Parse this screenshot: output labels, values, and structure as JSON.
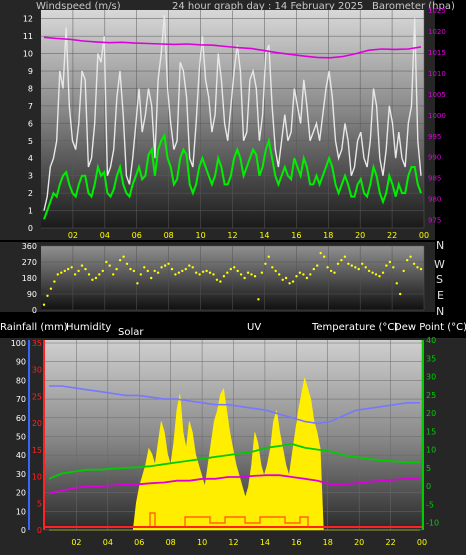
{
  "header": {
    "wind_label": "Windspeed (m/s)",
    "title": "24 hour graph day : 14 February 2025",
    "baro_label": "Barometer (hpa)"
  },
  "compass": [
    "N",
    "W",
    "S",
    "E",
    "N"
  ],
  "bottom_labels": {
    "rain": "Rainfall (mm)",
    "humidity": "Humidity",
    "solar": "Solar",
    "uv": "UV",
    "temp": "Temperature (°C)",
    "dew": "Dew Point (°C)"
  },
  "colors": {
    "wind_gust": "#e8e8e8",
    "wind_avg": "#00ee00",
    "barometer": "#dd00dd",
    "wind_dir": "#ffff00",
    "temperature": "#00cc00",
    "dew_point": "#dd00dd",
    "humidity": "#7777ff",
    "solar": "#ffee00",
    "uv": "#ff6600",
    "rain_axis": "#ff2222",
    "humidity_axis": "#3366ff",
    "temp_axis": "#00cc00"
  },
  "chart_data": [
    {
      "type": "line",
      "name": "wind-barometer",
      "x_ticks": [
        "02",
        "04",
        "06",
        "08",
        "10",
        "12",
        "14",
        "16",
        "18",
        "20",
        "22",
        "00"
      ],
      "y_left": {
        "label": "Windspeed (m/s)",
        "ticks": [
          0,
          1,
          2,
          3,
          4,
          5,
          6,
          7,
          8,
          9,
          10,
          11,
          12
        ],
        "range": [
          0,
          12.5
        ]
      },
      "y_right": {
        "label": "Barometer (hpa)",
        "ticks": [
          975,
          980,
          985,
          990,
          995,
          1000,
          1005,
          1010,
          1015,
          1020,
          1025
        ],
        "range": [
          973,
          1025
        ]
      },
      "series": [
        {
          "name": "gust",
          "values": [
            1.0,
            1.8,
            3.5,
            4.0,
            5.0,
            9.0,
            8.0,
            11.5,
            7.0,
            5.0,
            4.5,
            6.0,
            9.0,
            8.5,
            3.5,
            4.0,
            6.0,
            10.0,
            9.5,
            11.0,
            3.0,
            3.5,
            4.5,
            7.5,
            9.0,
            6.5,
            3.0,
            2.5,
            4.0,
            6.0,
            8.0,
            5.5,
            6.5,
            8.0,
            7.0,
            4.0,
            8.5,
            10.0,
            12.2,
            8.0,
            6.0,
            4.5,
            5.0,
            9.5,
            9.0,
            7.5,
            4.0,
            3.5,
            6.0,
            9.0,
            11.0,
            8.5,
            7.5,
            5.5,
            6.5,
            10.0,
            8.5,
            6.0,
            5.0,
            7.0,
            9.0,
            10.5,
            9.0,
            5.0,
            5.5,
            8.5,
            9.0,
            8.0,
            5.0,
            6.5,
            10.0,
            10.5,
            7.0,
            4.5,
            3.5,
            5.0,
            6.5,
            5.0,
            5.5,
            8.0,
            7.0,
            6.0,
            8.5,
            7.0,
            5.0,
            5.5,
            6.0,
            5.0,
            6.5,
            8.0,
            9.0,
            7.5,
            5.0,
            4.0,
            4.5,
            6.0,
            5.0,
            3.0,
            3.5,
            5.0,
            5.5,
            4.0,
            3.5,
            5.0,
            8.0,
            7.0,
            4.0,
            3.0,
            4.5,
            7.0,
            6.0,
            4.0,
            5.5,
            4.0,
            3.5,
            6.0,
            7.0,
            12.0,
            5.0,
            3.0
          ]
        },
        {
          "name": "average",
          "values": [
            0.5,
            1.0,
            1.5,
            2.0,
            1.8,
            2.5,
            3.0,
            3.2,
            2.5,
            2.0,
            1.8,
            2.5,
            3.0,
            3.0,
            2.0,
            1.8,
            2.5,
            3.5,
            3.0,
            3.2,
            2.0,
            1.8,
            2.2,
            3.0,
            3.5,
            2.5,
            2.0,
            1.8,
            2.5,
            3.0,
            3.5,
            2.8,
            3.0,
            4.2,
            4.5,
            3.0,
            4.5,
            5.0,
            5.3,
            4.0,
            3.5,
            2.5,
            2.8,
            4.0,
            4.5,
            4.2,
            2.5,
            2.0,
            2.5,
            3.5,
            4.0,
            3.5,
            3.0,
            2.5,
            3.0,
            4.0,
            3.5,
            2.5,
            2.5,
            3.0,
            4.0,
            4.5,
            4.0,
            3.0,
            3.5,
            4.0,
            4.5,
            4.2,
            3.0,
            3.5,
            4.5,
            5.0,
            4.0,
            3.0,
            2.5,
            3.0,
            3.5,
            3.0,
            2.8,
            4.0,
            3.5,
            3.0,
            4.0,
            3.5,
            2.5,
            2.5,
            3.0,
            2.5,
            3.0,
            3.5,
            4.0,
            3.5,
            2.5,
            2.0,
            2.5,
            3.0,
            2.5,
            1.8,
            1.8,
            2.5,
            2.8,
            2.0,
            1.8,
            2.5,
            3.5,
            3.0,
            2.0,
            1.5,
            2.0,
            3.0,
            2.5,
            1.8,
            2.5,
            2.0,
            2.0,
            3.0,
            3.5,
            3.5,
            2.5,
            2.0
          ]
        },
        {
          "name": "barometer",
          "values": [
            1018.5,
            1018.2,
            1018.0,
            1017.6,
            1017.4,
            1017.2,
            1017.3,
            1017.1,
            1017.0,
            1016.9,
            1016.8,
            1016.9,
            1016.7,
            1016.6,
            1016.3,
            1016.0,
            1015.8,
            1015.3,
            1014.8,
            1014.4,
            1014.0,
            1013.7,
            1013.6,
            1013.9,
            1014.6,
            1015.4,
            1015.7,
            1015.6,
            1015.7,
            1016.2
          ]
        }
      ]
    },
    {
      "type": "scatter",
      "name": "wind-direction",
      "x_ticks": [
        "02",
        "04",
        "06",
        "08",
        "10",
        "12",
        "14",
        "16",
        "18",
        "20",
        "22",
        "00"
      ],
      "y": {
        "ticks": [
          0,
          90,
          180,
          270,
          360
        ],
        "range": [
          0,
          360
        ]
      },
      "series": [
        {
          "name": "direction",
          "values": [
            30,
            80,
            120,
            160,
            200,
            210,
            220,
            230,
            240,
            200,
            220,
            250,
            230,
            200,
            170,
            180,
            200,
            220,
            270,
            250,
            200,
            230,
            280,
            300,
            260,
            230,
            220,
            150,
            200,
            240,
            220,
            180,
            220,
            210,
            240,
            250,
            260,
            230,
            200,
            210,
            220,
            230,
            250,
            240,
            210,
            200,
            215,
            220,
            210,
            200,
            170,
            160,
            190,
            210,
            230,
            240,
            220,
            200,
            180,
            210,
            200,
            190,
            60,
            210,
            260,
            300,
            240,
            220,
            200,
            170,
            180,
            150,
            160,
            190,
            210,
            200,
            180,
            200,
            230,
            250,
            320,
            300,
            240,
            220,
            210,
            260,
            280,
            300,
            260,
            250,
            240,
            230,
            260,
            240,
            220,
            210,
            200,
            190,
            210,
            250,
            270,
            240,
            150,
            90,
            220,
            280,
            300,
            260,
            240,
            230
          ]
        }
      ]
    },
    {
      "type": "line",
      "name": "temperature-humidity-solar",
      "x_ticks": [
        "02",
        "04",
        "06",
        "08",
        "10",
        "12",
        "14",
        "16",
        "18",
        "20",
        "22",
        "00"
      ],
      "y_left_rain": {
        "label": "Rainfall (mm)",
        "ticks": [
          0,
          5,
          10,
          15,
          20,
          25,
          30,
          35
        ],
        "range": [
          0,
          35
        ]
      },
      "y_left_humidity": {
        "label": "Humidity",
        "ticks": [
          0,
          10,
          20,
          30,
          40,
          50,
          60,
          70,
          80,
          90,
          100
        ],
        "range": [
          0,
          100
        ]
      },
      "y_right_temp": {
        "label": "Temperature (°C)",
        "ticks": [
          -10,
          -5,
          0,
          5,
          10,
          15,
          20,
          25,
          30,
          35,
          40
        ],
        "range": [
          -12,
          40
        ]
      },
      "series": [
        {
          "name": "humidity",
          "values": [
            77,
            77,
            76,
            75,
            74,
            73,
            72,
            72,
            71,
            70,
            70,
            69,
            68,
            67,
            67,
            66,
            65,
            64,
            62,
            60,
            58,
            57,
            58,
            61,
            64,
            65,
            66,
            67,
            68,
            68
          ]
        },
        {
          "name": "temperature",
          "values": [
            2.0,
            3.5,
            4.0,
            4.5,
            4.5,
            4.8,
            5.0,
            5.2,
            5.5,
            6.0,
            6.5,
            7.0,
            7.5,
            8.0,
            8.5,
            9.0,
            9.5,
            10.5,
            11.0,
            11.5,
            10.5,
            10.0,
            9.5,
            8.5,
            8.0,
            7.5,
            7.0,
            6.8,
            6.5,
            6.5
          ]
        },
        {
          "name": "dew_point",
          "values": [
            -2.0,
            -1.2,
            -0.5,
            0,
            0,
            0.2,
            0.5,
            0.5,
            0.8,
            1.0,
            1.5,
            1.5,
            2.0,
            2.0,
            2.5,
            2.5,
            2.8,
            3.0,
            3.0,
            2.5,
            2.0,
            1.5,
            0.5,
            0.5,
            0.8,
            1.2,
            1.5,
            1.8,
            2.0,
            2.0
          ]
        },
        {
          "name": "solar",
          "values": [
            0,
            0,
            0,
            0,
            0,
            0,
            0,
            0,
            0,
            0,
            0,
            0,
            0,
            0,
            0,
            0,
            0,
            0,
            0,
            0,
            0,
            0,
            0,
            0,
            0,
            0,
            0,
            0,
            5,
            8,
            10,
            12,
            15,
            14,
            12,
            16,
            20,
            18,
            14,
            12,
            16,
            22,
            25,
            18,
            15,
            20,
            18,
            14,
            12,
            10,
            8,
            12,
            16,
            20,
            22,
            25,
            26,
            22,
            18,
            15,
            12,
            10,
            8,
            6,
            8,
            12,
            18,
            16,
            12,
            10,
            12,
            15,
            20,
            22,
            18,
            15,
            12,
            10,
            14,
            18,
            22,
            25,
            28,
            26,
            24,
            20,
            18,
            15,
            0,
            0,
            0,
            0,
            0,
            0,
            0,
            0,
            0,
            0,
            0,
            0,
            0,
            0,
            0,
            0,
            0,
            0,
            0,
            0,
            0,
            0,
            0,
            0,
            0,
            0,
            0,
            0,
            0,
            0,
            0,
            0
          ]
        }
      ]
    }
  ]
}
